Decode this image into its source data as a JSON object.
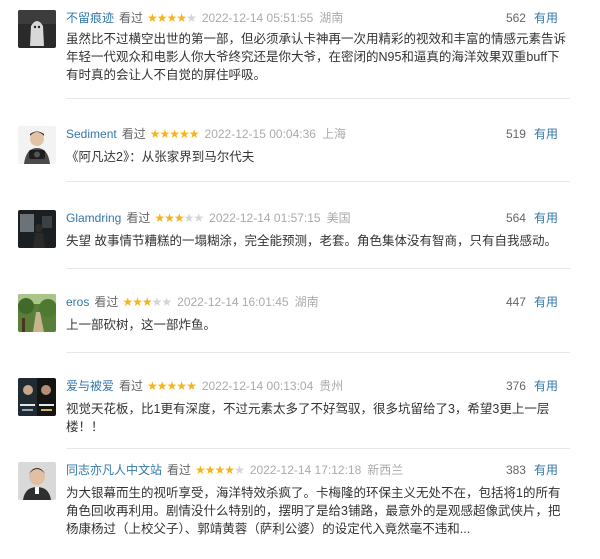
{
  "colors": {
    "link": "#3377aa",
    "star": "#f6b417",
    "star_off": "#d5d5d5",
    "meta": "#aaaaaa",
    "text": "#333333"
  },
  "reviews": [
    {
      "user": "不留痕迹",
      "status": "看过",
      "rating": 4,
      "time": "2022-12-14 05:51:55",
      "location": "湖南",
      "votes": "562",
      "useful_label": "有用",
      "content": "虽然比不过横空出世的第一部，但必须承认卡神再一次用精彩的视效和丰富的情感元素告诉年轻一代观众和电影人你大爷终究还是你大爷，在密闭的N95和逼真的海洋效果双重buff下有时真的会让人不自觉的屏住呼吸。",
      "avatar_icon": "ghost-sheet-avatar"
    },
    {
      "user": "Sediment",
      "status": "看过",
      "rating": 5,
      "time": "2022-12-15 00:04:36",
      "location": "上海",
      "votes": "519",
      "useful_label": "有用",
      "content": "《阿凡达2》：从张家界到马尔代夫",
      "avatar_icon": "man-with-camera-avatar"
    },
    {
      "user": "Glamdring",
      "status": "看过",
      "rating": 3,
      "time": "2022-12-14 01:57:15",
      "location": "美国",
      "votes": "564",
      "useful_label": "有用",
      "content": "失望 故事情节糟糕的一塌糊涂，完全能预测，老套。角色集体没有智商，只有自我感动。",
      "avatar_icon": "dark-room-figure-avatar"
    },
    {
      "user": "eros",
      "status": "看过",
      "rating": 3,
      "time": "2022-12-14 16:01:45",
      "location": "湖南",
      "votes": "447",
      "useful_label": "有用",
      "content": "上一部砍树，这一部炸鱼。",
      "avatar_icon": "forest-path-avatar"
    },
    {
      "user": "爱与被爱",
      "status": "看过",
      "rating": 5,
      "time": "2022-12-14 00:13:04",
      "location": "贵州",
      "votes": "376",
      "useful_label": "有用",
      "content": "视觉天花板，比1更有深度，不过元素太多了不好驾驭，很多坑留给了3，希望3更上一层楼！！",
      "avatar_icon": "movie-poster-avatar"
    },
    {
      "user": "同志亦凡人中文站",
      "status": "看过",
      "rating": 4,
      "time": "2022-12-14 17:12:18",
      "location": "新西兰",
      "votes": "383",
      "useful_label": "有用",
      "content": "为大银幕而生的视听享受，海洋特效杀疯了。卡梅隆的环保主义无处不在，包括将1的所有角色回收再利用。剧情没什么特别的，摆明了是给3铺路，最意外的是观感超像武侠片，把杨康杨过（上校父子）、郭靖黄蓉（萨利公婆）的设定代入竟然毫不违和...",
      "avatar_icon": "man-portrait-avatar"
    }
  ]
}
